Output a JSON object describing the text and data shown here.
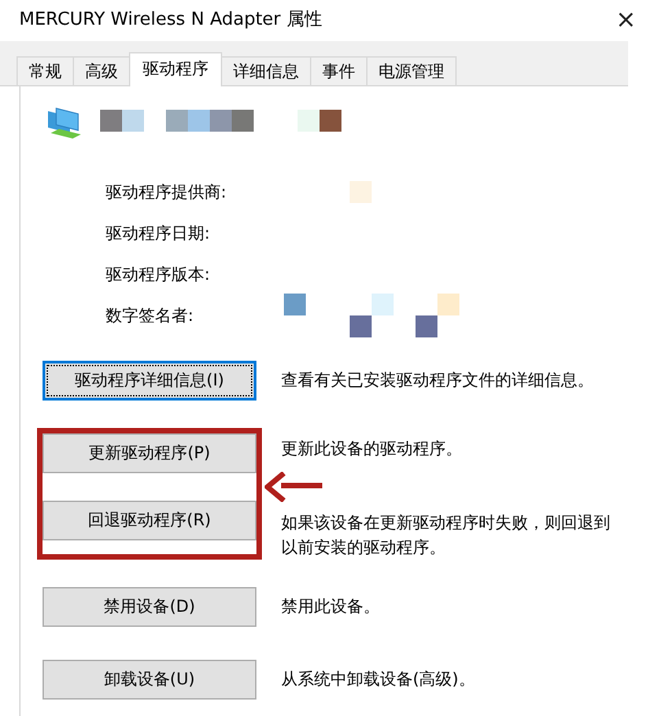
{
  "window": {
    "title": "MERCURY Wireless N Adapter 属性",
    "close": "×"
  },
  "tabs": [
    {
      "label": "常规",
      "selected": false
    },
    {
      "label": "高级",
      "selected": false
    },
    {
      "label": "驱动程序",
      "selected": true
    },
    {
      "label": "详细信息",
      "selected": false
    },
    {
      "label": "事件",
      "selected": false
    },
    {
      "label": "电源管理",
      "selected": false
    }
  ],
  "device": {
    "name_redacted": true
  },
  "info_rows": [
    {
      "label": "驱动程序提供商:",
      "redacted": true
    },
    {
      "label": "驱动程序日期:",
      "redacted": false
    },
    {
      "label": "驱动程序版本:",
      "redacted": false
    },
    {
      "label": "数字签名者:",
      "redacted": true
    }
  ],
  "actions": [
    {
      "button": "驱动程序详细信息(I)",
      "description": "查看有关已安装驱动程序文件的详细信息。",
      "focused": true,
      "highlighted": false
    },
    {
      "button": "更新驱动程序(P)",
      "description": "更新此设备的驱动程序。",
      "focused": false,
      "highlighted": true
    },
    {
      "button": "回退驱动程序(R)",
      "description": "如果该设备在更新驱动程序时失败，则回退到以前安装的驱动程序。",
      "focused": false,
      "highlighted": true
    },
    {
      "button": "禁用设备(D)",
      "description": "禁用此设备。",
      "focused": false,
      "highlighted": false
    },
    {
      "button": "卸载设备(U)",
      "description": "从系统中卸载设备(高级)。",
      "focused": false,
      "highlighted": false
    }
  ]
}
